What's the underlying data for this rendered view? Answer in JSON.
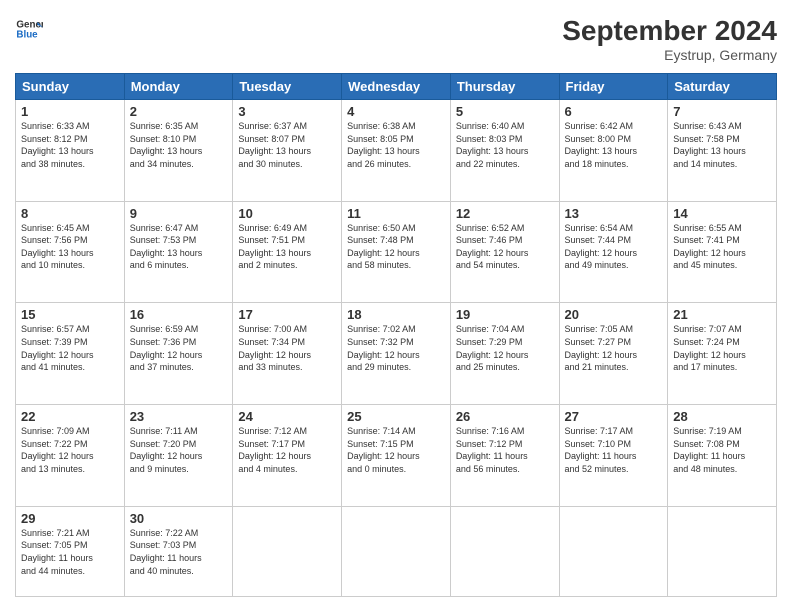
{
  "header": {
    "logo_line1": "General",
    "logo_line2": "Blue",
    "month_title": "September 2024",
    "location": "Eystrup, Germany"
  },
  "days_of_week": [
    "Sunday",
    "Monday",
    "Tuesday",
    "Wednesday",
    "Thursday",
    "Friday",
    "Saturday"
  ],
  "weeks": [
    [
      {
        "day": "1",
        "sunrise": "6:33 AM",
        "sunset": "8:12 PM",
        "daylight_h": "13",
        "daylight_m": "38"
      },
      {
        "day": "2",
        "sunrise": "6:35 AM",
        "sunset": "8:10 PM",
        "daylight_h": "13",
        "daylight_m": "34"
      },
      {
        "day": "3",
        "sunrise": "6:37 AM",
        "sunset": "8:07 PM",
        "daylight_h": "13",
        "daylight_m": "30"
      },
      {
        "day": "4",
        "sunrise": "6:38 AM",
        "sunset": "8:05 PM",
        "daylight_h": "13",
        "daylight_m": "26"
      },
      {
        "day": "5",
        "sunrise": "6:40 AM",
        "sunset": "8:03 PM",
        "daylight_h": "13",
        "daylight_m": "22"
      },
      {
        "day": "6",
        "sunrise": "6:42 AM",
        "sunset": "8:00 PM",
        "daylight_h": "13",
        "daylight_m": "18"
      },
      {
        "day": "7",
        "sunrise": "6:43 AM",
        "sunset": "7:58 PM",
        "daylight_h": "13",
        "daylight_m": "14"
      }
    ],
    [
      {
        "day": "8",
        "sunrise": "6:45 AM",
        "sunset": "7:56 PM",
        "daylight_h": "13",
        "daylight_m": "10"
      },
      {
        "day": "9",
        "sunrise": "6:47 AM",
        "sunset": "7:53 PM",
        "daylight_h": "13",
        "daylight_m": "6"
      },
      {
        "day": "10",
        "sunrise": "6:49 AM",
        "sunset": "7:51 PM",
        "daylight_h": "13",
        "daylight_m": "2"
      },
      {
        "day": "11",
        "sunrise": "6:50 AM",
        "sunset": "7:48 PM",
        "daylight_h": "12",
        "daylight_m": "58"
      },
      {
        "day": "12",
        "sunrise": "6:52 AM",
        "sunset": "7:46 PM",
        "daylight_h": "12",
        "daylight_m": "54"
      },
      {
        "day": "13",
        "sunrise": "6:54 AM",
        "sunset": "7:44 PM",
        "daylight_h": "12",
        "daylight_m": "49"
      },
      {
        "day": "14",
        "sunrise": "6:55 AM",
        "sunset": "7:41 PM",
        "daylight_h": "12",
        "daylight_m": "45"
      }
    ],
    [
      {
        "day": "15",
        "sunrise": "6:57 AM",
        "sunset": "7:39 PM",
        "daylight_h": "12",
        "daylight_m": "41"
      },
      {
        "day": "16",
        "sunrise": "6:59 AM",
        "sunset": "7:36 PM",
        "daylight_h": "12",
        "daylight_m": "37"
      },
      {
        "day": "17",
        "sunrise": "7:00 AM",
        "sunset": "7:34 PM",
        "daylight_h": "12",
        "daylight_m": "33"
      },
      {
        "day": "18",
        "sunrise": "7:02 AM",
        "sunset": "7:32 PM",
        "daylight_h": "12",
        "daylight_m": "29"
      },
      {
        "day": "19",
        "sunrise": "7:04 AM",
        "sunset": "7:29 PM",
        "daylight_h": "12",
        "daylight_m": "25"
      },
      {
        "day": "20",
        "sunrise": "7:05 AM",
        "sunset": "7:27 PM",
        "daylight_h": "12",
        "daylight_m": "21"
      },
      {
        "day": "21",
        "sunrise": "7:07 AM",
        "sunset": "7:24 PM",
        "daylight_h": "12",
        "daylight_m": "17"
      }
    ],
    [
      {
        "day": "22",
        "sunrise": "7:09 AM",
        "sunset": "7:22 PM",
        "daylight_h": "12",
        "daylight_m": "13"
      },
      {
        "day": "23",
        "sunrise": "7:11 AM",
        "sunset": "7:20 PM",
        "daylight_h": "12",
        "daylight_m": "9"
      },
      {
        "day": "24",
        "sunrise": "7:12 AM",
        "sunset": "7:17 PM",
        "daylight_h": "12",
        "daylight_m": "4"
      },
      {
        "day": "25",
        "sunrise": "7:14 AM",
        "sunset": "7:15 PM",
        "daylight_h": "12",
        "daylight_m": "0"
      },
      {
        "day": "26",
        "sunrise": "7:16 AM",
        "sunset": "7:12 PM",
        "daylight_h": "11",
        "daylight_m": "56"
      },
      {
        "day": "27",
        "sunrise": "7:17 AM",
        "sunset": "7:10 PM",
        "daylight_h": "11",
        "daylight_m": "52"
      },
      {
        "day": "28",
        "sunrise": "7:19 AM",
        "sunset": "7:08 PM",
        "daylight_h": "11",
        "daylight_m": "48"
      }
    ],
    [
      {
        "day": "29",
        "sunrise": "7:21 AM",
        "sunset": "7:05 PM",
        "daylight_h": "11",
        "daylight_m": "44"
      },
      {
        "day": "30",
        "sunrise": "7:22 AM",
        "sunset": "7:03 PM",
        "daylight_h": "11",
        "daylight_m": "40"
      },
      null,
      null,
      null,
      null,
      null
    ]
  ]
}
